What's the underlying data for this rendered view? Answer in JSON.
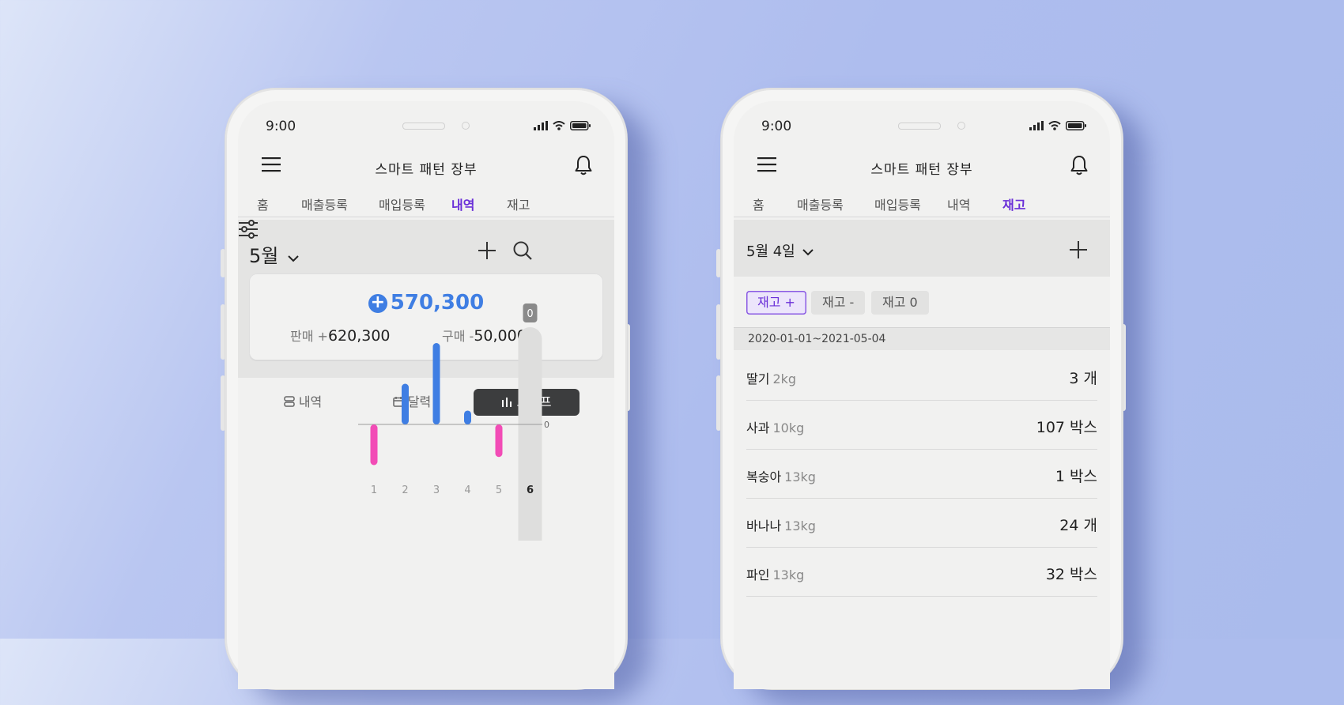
{
  "left_phone": {
    "status": {
      "time": "9:00"
    },
    "app_title": "스마트 패턴 장부",
    "tabs": [
      {
        "label": "홈"
      },
      {
        "label": "매출등록"
      },
      {
        "label": "매입등록"
      },
      {
        "label": "내역",
        "active": true
      },
      {
        "label": "재고"
      }
    ],
    "month_selector": "5월",
    "summary": {
      "total": "570,300",
      "sales_label": "판매 +",
      "sales_value": "620,300",
      "purchase_label": "구매 -",
      "purchase_value": "50,000"
    },
    "view_toggle": [
      {
        "label": "내역",
        "icon": "list-icon"
      },
      {
        "label": "달력",
        "icon": "calendar-icon"
      },
      {
        "label": "그래프",
        "icon": "bar-chart-icon",
        "active": true
      }
    ],
    "chart_data": {
      "type": "bar",
      "categories": [
        "1",
        "2",
        "3",
        "4",
        "5",
        "6"
      ],
      "values": [
        -50,
        50,
        100,
        17,
        -40,
        0
      ],
      "zero_label": "0",
      "highlight_label": "0",
      "highlight_category": "6",
      "colors": {
        "positive": "#3f7ee3",
        "negative": "#f24cb6"
      }
    }
  },
  "right_phone": {
    "status": {
      "time": "9:00"
    },
    "app_title": "스마트 패턴 장부",
    "tabs": [
      {
        "label": "홈"
      },
      {
        "label": "매출등록"
      },
      {
        "label": "매입등록"
      },
      {
        "label": "내역"
      },
      {
        "label": "재고",
        "active": true
      }
    ],
    "date_selector": "5월 4일",
    "filters": [
      {
        "label": "재고 +",
        "active": true
      },
      {
        "label": "재고 -"
      },
      {
        "label": "재고 0"
      }
    ],
    "date_range": "2020-01-01~2021-05-04",
    "items": [
      {
        "name": "딸기",
        "spec": "2kg",
        "qty": "3 개"
      },
      {
        "name": "사과",
        "spec": "10kg",
        "qty": "107 박스"
      },
      {
        "name": "복숭아",
        "spec": "13kg",
        "qty": "1 박스"
      },
      {
        "name": "바나나",
        "spec": "13kg",
        "qty": "24 개"
      },
      {
        "name": "파인",
        "spec": "13kg",
        "qty": "32 박스"
      }
    ]
  },
  "colors": {
    "accent": "#6a2fd8",
    "positive": "#3f7ee3",
    "negative": "#f24cb6"
  }
}
